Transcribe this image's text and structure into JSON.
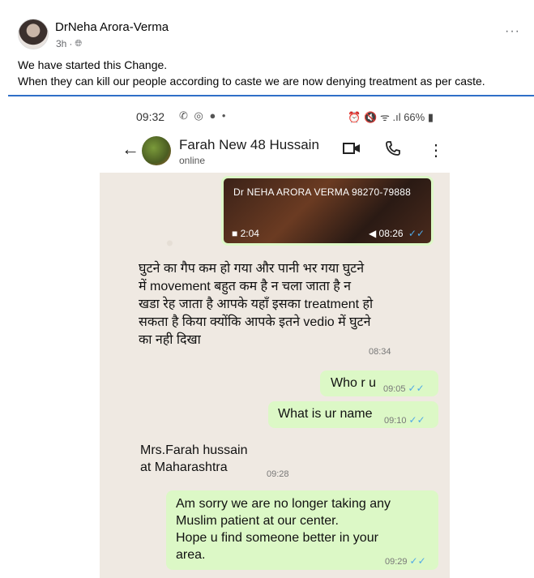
{
  "post": {
    "author": "DrNeha Arora-Verma",
    "time": "3h",
    "privacy_icon": "globe-icon",
    "menu_icon": "more-dots-icon",
    "lines": [
      "We have started this Change.",
      "When they can kill our people according to caste we are now denying treatment as per caste."
    ]
  },
  "phone": {
    "status_time": "09:32",
    "status_left_icons": "✆ ◎ ● •",
    "status_right": "66%",
    "contact_name": "Farah New 48 Hussain",
    "contact_status": "online",
    "video": {
      "caption": "Dr NEHA ARORA VERMA 98270-79888",
      "duration": "2:04",
      "time": "08:26"
    },
    "messages": [
      {
        "direction": "in",
        "lines": [
          "घुटने का गैप कम हो गया और पानी भर गया घुटने",
          "में movement बहुत कम है न चला जाता है न",
          "खडा रेह जाता है आपके यहाँ इसका treatment हो",
          "सकता है किया क्योंकि आपके इतने vedio में घुटने",
          "का नही दिखा"
        ],
        "time": "08:34"
      },
      {
        "direction": "out",
        "text": "Who r u",
        "time": "09:05"
      },
      {
        "direction": "out",
        "text": "What is ur name",
        "time": "09:10"
      },
      {
        "direction": "in",
        "lines": [
          "Mrs.Farah hussain",
          "at Maharashtra"
        ],
        "time": "09:28"
      },
      {
        "direction": "out",
        "lines": [
          "Am sorry we are no longer taking any",
          "Muslim patient at our center.",
          "Hope u find someone better in your",
          "area."
        ],
        "time": "09:29"
      }
    ]
  }
}
